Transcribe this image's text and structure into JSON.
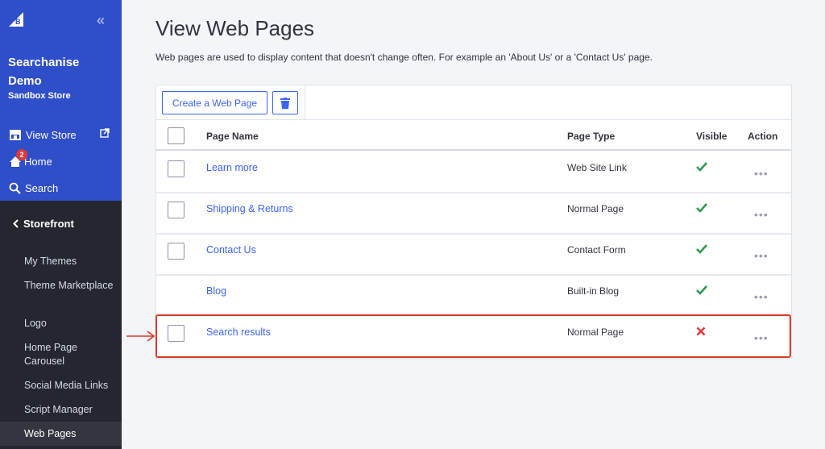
{
  "sidebar": {
    "store_name": "Searchanise Demo",
    "store_subtitle": "Sandbox Store",
    "view_store": "View Store",
    "home": "Home",
    "home_badge": "2",
    "search": "Search",
    "section": "Storefront",
    "items": [
      {
        "label": "My Themes"
      },
      {
        "label": "Theme Marketplace"
      },
      {
        "label": "Logo"
      },
      {
        "label": "Home Page Carousel"
      },
      {
        "label": "Social Media Links"
      },
      {
        "label": "Script Manager"
      },
      {
        "label": "Web Pages",
        "active": true
      }
    ]
  },
  "main": {
    "title": "View Web Pages",
    "description": "Web pages are used to display content that doesn't change often. For example an 'About Us' or a 'Contact Us' page.",
    "create_button": "Create a Web Page",
    "columns": [
      "Page Name",
      "Page Type",
      "Visible",
      "Action"
    ],
    "rows": [
      {
        "name": "Learn more",
        "type": "Web Site Link",
        "visible": true,
        "has_checkbox": true
      },
      {
        "name": "Shipping & Returns",
        "type": "Normal Page",
        "visible": true,
        "has_checkbox": true
      },
      {
        "name": "Contact Us",
        "type": "Contact Form",
        "visible": true,
        "has_checkbox": true
      },
      {
        "name": "Blog",
        "type": "Built-in Blog",
        "visible": true,
        "has_checkbox": false
      },
      {
        "name": "Search results",
        "type": "Normal Page",
        "visible": false,
        "has_checkbox": true
      }
    ],
    "action_glyph": "•••"
  },
  "colors": {
    "sidebar_top": "#2f4ec9",
    "sidebar_bottom": "#24272f",
    "link": "#3c64f4",
    "check": "#2e9b4b",
    "cross": "#e03a3a",
    "highlight": "#d73b2a"
  }
}
